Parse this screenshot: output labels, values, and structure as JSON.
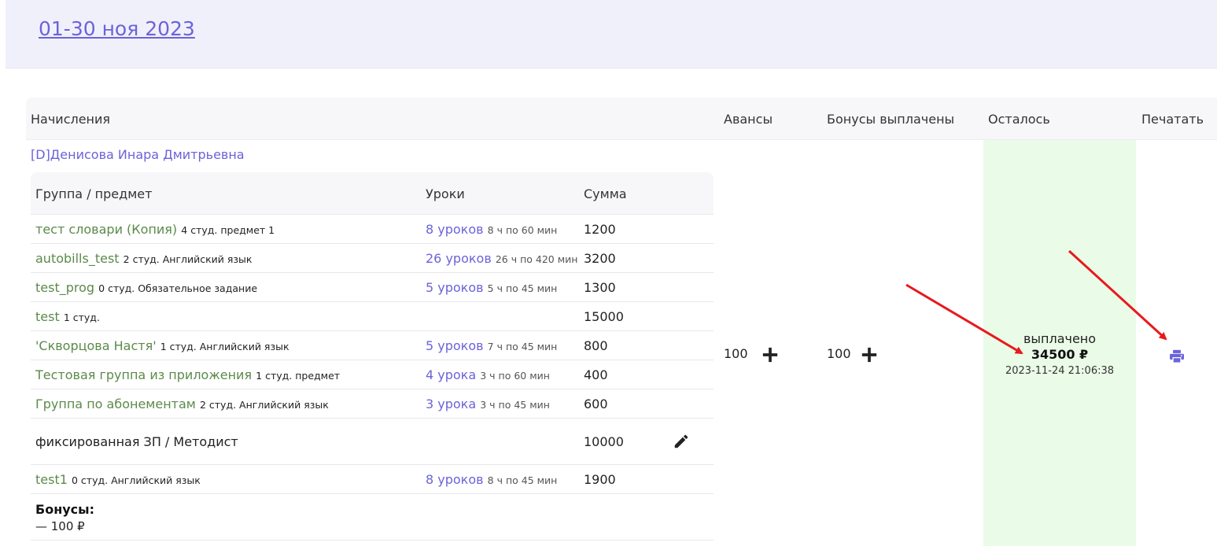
{
  "header": {
    "period_link": "01-30 ноя 2023"
  },
  "table": {
    "headers": {
      "accruals": "Начисления",
      "advances": "Авансы",
      "bonuses_paid": "Бонусы выплачены",
      "remaining": "Осталось",
      "print": "Печатать"
    },
    "teacher": "[D]Денисова Инара Дмитрьевна",
    "inner_headers": {
      "group": "Группа / предмет",
      "lessons": "Уроки",
      "sum": "Сумма"
    },
    "rows": [
      {
        "group": "тест словари (Копия)",
        "meta": "4 студ. предмет 1",
        "lessons": "8 уроков",
        "lessons_meta": "8 ч по 60 мин",
        "sum": "1200"
      },
      {
        "group": "autobills_test",
        "meta": "2 студ. Английский язык",
        "lessons": "26 уроков",
        "lessons_meta": "26 ч по 420 мин",
        "sum": "3200"
      },
      {
        "group": "test_prog",
        "meta": "0 студ. Обязательное задание",
        "lessons": "5 уроков",
        "lessons_meta": "5 ч по 45 мин",
        "sum": "1300"
      },
      {
        "group": "test",
        "meta": "1 студ.",
        "lessons": "",
        "lessons_meta": "",
        "sum": "15000"
      },
      {
        "group": "'Скворцова Настя'",
        "meta": "1 студ. Английский язык",
        "lessons": "5 уроков",
        "lessons_meta": "7 ч по 45 мин",
        "sum": "800"
      },
      {
        "group": "Тестовая группа из приложения",
        "meta": "1 студ. предмет",
        "lessons": "4 урока",
        "lessons_meta": "3 ч по 60 мин",
        "sum": "400"
      },
      {
        "group": "Группа по абонементам",
        "meta": "2 студ. Английский язык",
        "lessons": "3 урока",
        "lessons_meta": "3 ч по 45 мин",
        "sum": "600"
      }
    ],
    "fixed_row": {
      "label": "фиксированная ЗП / Методист",
      "sum": "10000"
    },
    "last_row": {
      "group": "test1",
      "meta": "0 студ. Английский язык",
      "lessons": "8 уроков",
      "lessons_meta": "8 ч по 45 мин",
      "sum": "1900"
    },
    "bonuses": {
      "title": "Бонусы:",
      "value": "— 100 ₽"
    },
    "advances_value": "100",
    "bonuses_paid_value": "100",
    "remaining": {
      "status": "выплачено",
      "amount": "34500 ₽",
      "datetime": "2023-11-24 21:06:38"
    }
  },
  "colors": {
    "accent": "#6b63d9",
    "group_link": "#5b8a4a",
    "paid_bg": "#eafbe7",
    "annotation_arrow": "#e8191c"
  },
  "icons": {
    "add": "plus-icon",
    "edit": "pencil-icon",
    "print": "printer-icon"
  }
}
